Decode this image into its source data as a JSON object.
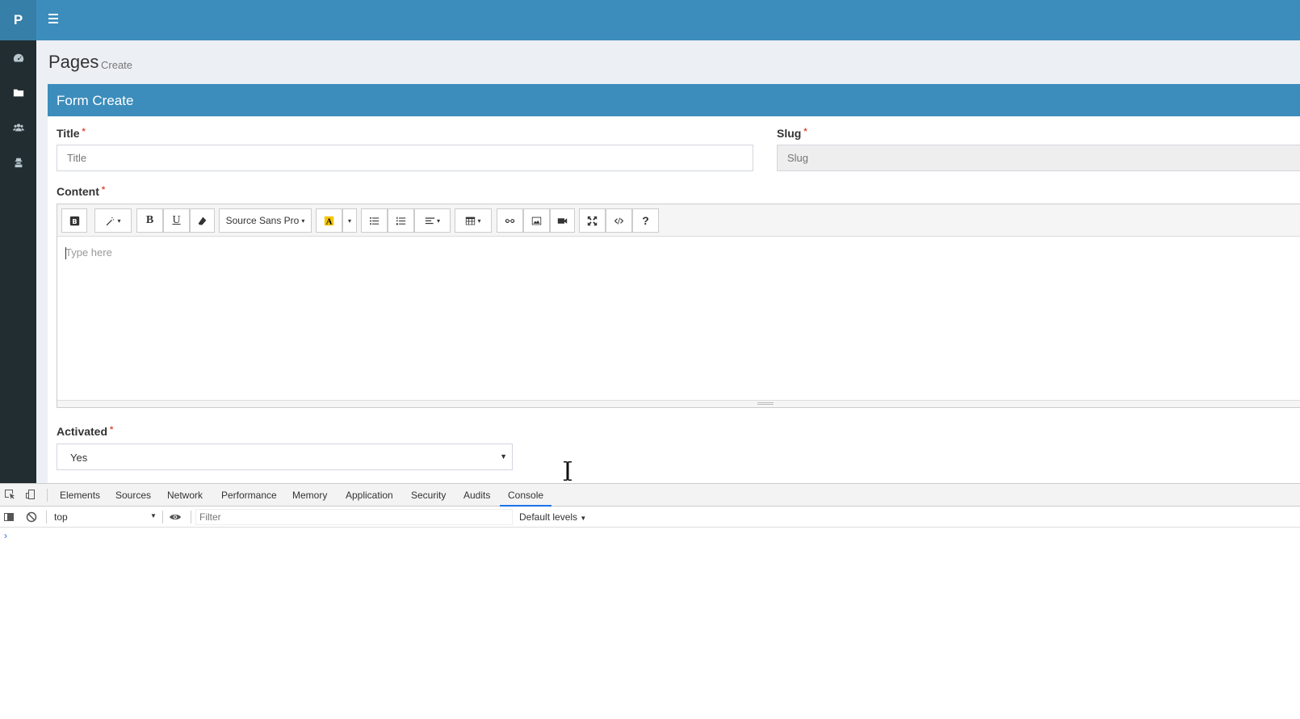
{
  "brand": {
    "letter": "P",
    "color": "#3c8dbc"
  },
  "sidebar": {
    "items": [
      {
        "icon": "dashboard-icon"
      },
      {
        "icon": "folder-icon",
        "active": true
      },
      {
        "icon": "users-icon"
      },
      {
        "icon": "user-secret-icon"
      }
    ]
  },
  "header": {
    "title": "Pages",
    "subtitle": "Create"
  },
  "form": {
    "box_title": "Form Create",
    "title_label": "Title",
    "title_placeholder": "Title",
    "slug_label": "Slug",
    "slug_placeholder": "Slug",
    "content_label": "Content",
    "required_mark": "*",
    "editor_placeholder": "Type here",
    "font_name": "Source Sans Pro",
    "activated_label": "Activated",
    "activated_value": "Yes"
  },
  "devtools": {
    "tabs": [
      "Elements",
      "Sources",
      "Network",
      "Performance",
      "Memory",
      "Application",
      "Security",
      "Audits",
      "Console"
    ],
    "active_tab": "Console",
    "context": "top",
    "filter_placeholder": "Filter",
    "levels": "Default levels",
    "prompt": "›"
  }
}
